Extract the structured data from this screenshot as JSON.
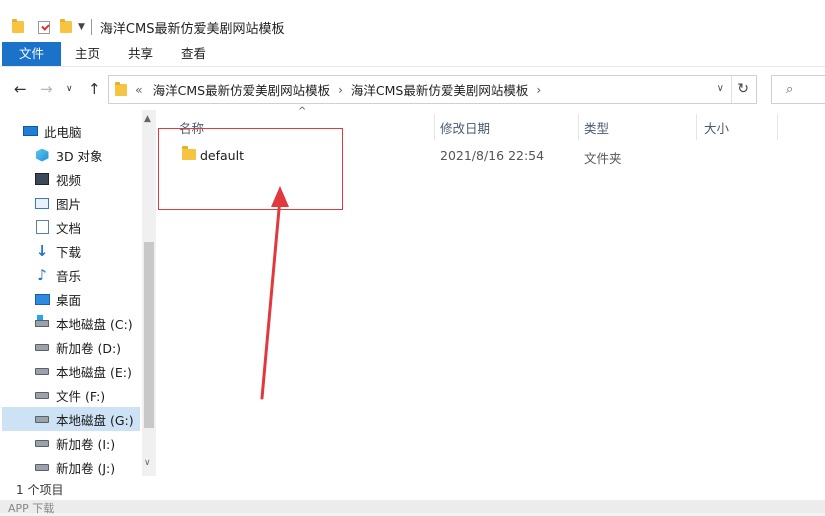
{
  "window": {
    "title": "海洋CMS最新仿爱美剧网站模板"
  },
  "ribbon": {
    "tabs": [
      "文件",
      "主页",
      "共享",
      "查看"
    ]
  },
  "address": {
    "overflow": "«",
    "crumbs": [
      "海洋CMS最新仿爱美剧网站模板",
      "海洋CMS最新仿爱美剧网站模板"
    ]
  },
  "sidebar": {
    "items": [
      {
        "label": "此电脑",
        "icon": "computer-icon"
      },
      {
        "label": "3D 对象",
        "icon": "3d-objects-icon"
      },
      {
        "label": "视频",
        "icon": "video-icon"
      },
      {
        "label": "图片",
        "icon": "pictures-icon"
      },
      {
        "label": "文档",
        "icon": "documents-icon"
      },
      {
        "label": "下载",
        "icon": "download-icon"
      },
      {
        "label": "音乐",
        "icon": "music-icon"
      },
      {
        "label": "桌面",
        "icon": "desktop-icon"
      },
      {
        "label": "本地磁盘 (C:)",
        "icon": "system-drive-icon"
      },
      {
        "label": "新加卷 (D:)",
        "icon": "drive-icon"
      },
      {
        "label": "本地磁盘 (E:)",
        "icon": "drive-icon"
      },
      {
        "label": "文件 (F:)",
        "icon": "drive-icon"
      },
      {
        "label": "本地磁盘 (G:)",
        "icon": "drive-icon",
        "selected": true
      },
      {
        "label": "新加卷 (I:)",
        "icon": "drive-icon"
      },
      {
        "label": "新加卷 (J:)",
        "icon": "drive-icon"
      }
    ]
  },
  "columns": {
    "name": "名称",
    "date": "修改日期",
    "type": "类型",
    "size": "大小"
  },
  "files": [
    {
      "name": "default",
      "date": "2021/8/16 22:54",
      "type": "文件夹",
      "icon": "folder-icon"
    }
  ],
  "status": {
    "count": "1 个项目"
  },
  "background": {
    "bottom_text": "APP 下载"
  },
  "annotation": {
    "color": "#e0393e"
  },
  "colors": {
    "file_tab": "#1a73c8",
    "selection": "#cde2f5"
  }
}
